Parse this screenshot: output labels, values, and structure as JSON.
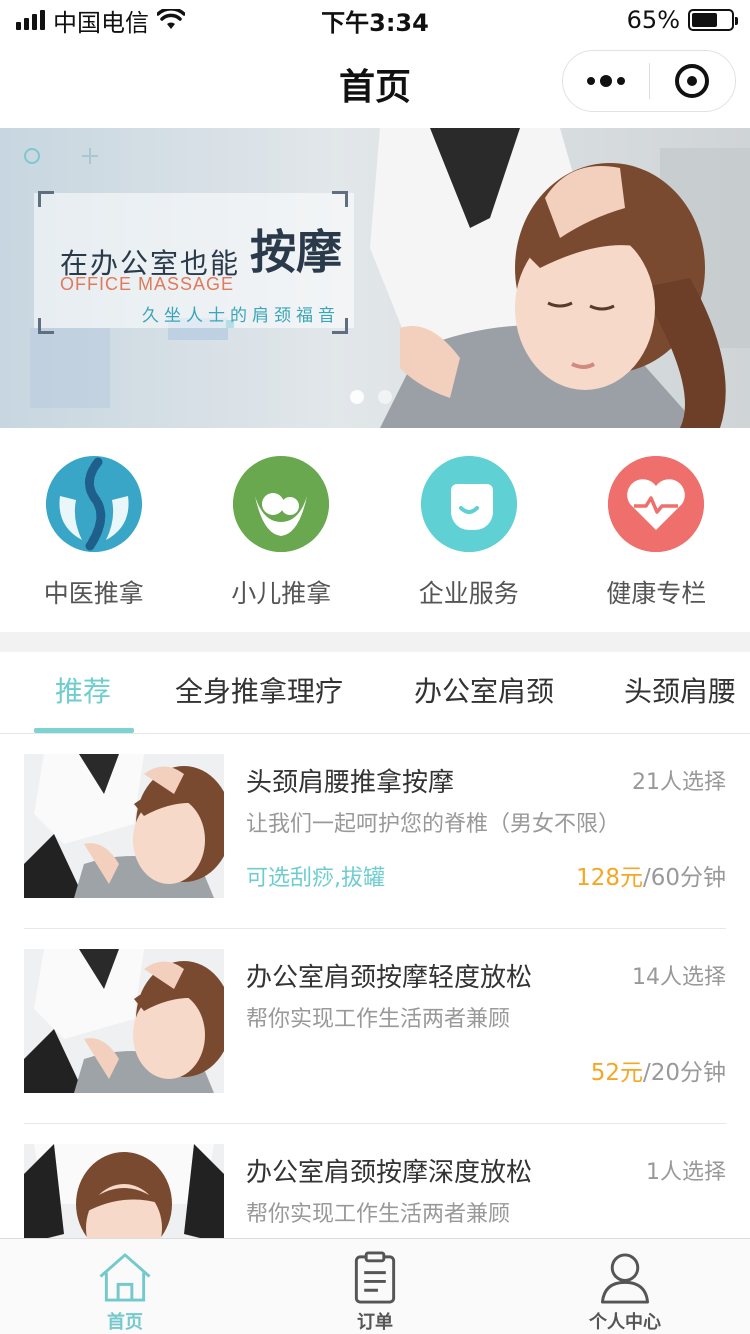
{
  "status_bar": {
    "carrier": "中国电信",
    "time": "下午3:34",
    "battery_text": "65%",
    "battery_level": 0.65
  },
  "nav": {
    "title": "首页"
  },
  "banner": {
    "headline": "在办公室也能",
    "headline_big": "按摩",
    "english": "OFFICE MASSAGE",
    "subline": "久坐人士的肩颈福音",
    "dots": 2,
    "active_dot": 0
  },
  "categories": [
    {
      "label": "中医推拿",
      "icon": "spine-hands-icon",
      "color": "#3aa6c7"
    },
    {
      "label": "小儿推拿",
      "icon": "child-massage-icon",
      "color": "#6aa84f",
      "badge": "小儿推拿"
    },
    {
      "label": "企业服务",
      "icon": "chat-bubble-icon",
      "color": "#5fd0d4"
    },
    {
      "label": "健康专栏",
      "icon": "heart-pulse-icon",
      "color": "#ef6f6c"
    }
  ],
  "tabs": [
    {
      "label": "推荐",
      "active": true
    },
    {
      "label": "全身推拿理疗",
      "active": false
    },
    {
      "label": "办公室肩颈",
      "active": false
    },
    {
      "label": "头颈肩腰",
      "active": false
    }
  ],
  "items": [
    {
      "title": "头颈肩腰推拿按摩",
      "count": "21人选择",
      "desc": "让我们一起呵护您的脊椎（男女不限）",
      "extra": "可选刮痧,拔罐",
      "price": "128元",
      "unit": "/60分钟"
    },
    {
      "title": "办公室肩颈按摩轻度放松",
      "count": "14人选择",
      "desc": "帮你实现工作生活两者兼顾",
      "extra": "",
      "price": "52元",
      "unit": "/20分钟"
    },
    {
      "title": "办公室肩颈按摩深度放松",
      "count": "1人选择",
      "desc": "帮你实现工作生活两者兼顾",
      "extra": "",
      "price": "",
      "unit": ""
    }
  ],
  "tabbar": [
    {
      "label": "首页",
      "icon": "home-icon",
      "active": true
    },
    {
      "label": "订单",
      "icon": "clipboard-icon",
      "active": false
    },
    {
      "label": "个人中心",
      "icon": "user-icon",
      "active": false
    }
  ],
  "colors": {
    "accent": "#6fcdcf",
    "price": "#f5a623",
    "muted": "#999999"
  }
}
